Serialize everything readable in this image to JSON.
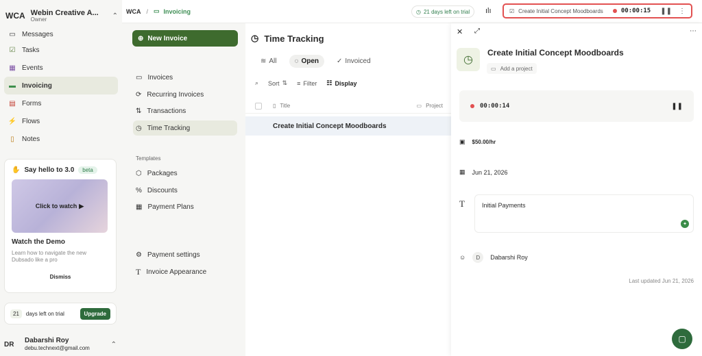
{
  "workspace": {
    "abbr": "WCA",
    "name": "Webin Creative A...",
    "role": "Owner"
  },
  "nav": [
    {
      "label": "Messages",
      "icon": "message-icon"
    },
    {
      "label": "Tasks",
      "icon": "tasks-icon"
    },
    {
      "label": "Events",
      "icon": "calendar-icon"
    },
    {
      "label": "Invoicing",
      "icon": "invoice-icon"
    },
    {
      "label": "Forms",
      "icon": "forms-icon"
    },
    {
      "label": "Flows",
      "icon": "flows-icon"
    },
    {
      "label": "Notes",
      "icon": "notes-icon"
    }
  ],
  "promo": {
    "title": "Say hello to 3.0",
    "badge": "beta",
    "video_label": "Click to watch",
    "heading": "Watch the Demo",
    "subtitle": "Learn how to navigate the new Dubsado like a pro",
    "dismiss": "Dismiss"
  },
  "trial": {
    "days": "21",
    "text": "days left on trial",
    "upgrade": "Upgrade"
  },
  "user": {
    "initials": "DR",
    "name": "Dabarshi Roy",
    "email": "debu.technext@gmail.com"
  },
  "breadcrumb": {
    "root": "WCA",
    "separator": "/",
    "current": "Invoicing"
  },
  "topbar": {
    "trial_text": "21 days left on trial",
    "active_timer_title": "Create Initial Concept Moodboards",
    "active_timer_time": "00:00:15"
  },
  "subnav": {
    "new_invoice": "New Invoice",
    "items": [
      "Invoices",
      "Recurring Invoices",
      "Transactions",
      "Time Tracking"
    ],
    "templates_heading": "Templates",
    "template_items": [
      "Packages",
      "Discounts",
      "Payment Plans"
    ],
    "bottom_items": [
      "Payment settings",
      "Invoice Appearance"
    ]
  },
  "list": {
    "title": "Time Tracking",
    "filters": [
      "All",
      "Open",
      "Invoiced"
    ],
    "toolbar": {
      "sort": "Sort",
      "filter": "Filter",
      "display": "Display"
    },
    "columns": {
      "title": "Title",
      "project": "Project"
    },
    "rows": [
      "Create Initial Concept Moodboards"
    ]
  },
  "detail": {
    "title": "Create Initial Concept Moodboards",
    "add_project": "Add a project",
    "timer": "00:00:14",
    "rate": "$50.00/hr",
    "date": "Jun 21, 2026",
    "notes": "Initial Payments",
    "assignee_initial": "D",
    "assignee": "Dabarshi Roy",
    "last_updated": "Last updated Jun 21, 2026"
  }
}
